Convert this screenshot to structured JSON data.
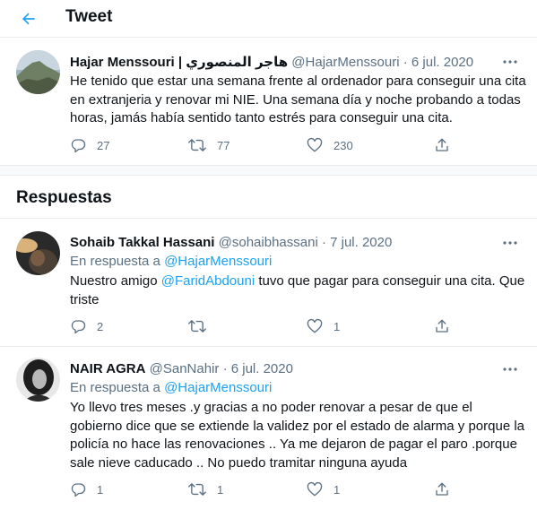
{
  "header": {
    "title": "Tweet"
  },
  "main_tweet": {
    "name": "Hajar Menssouri | هاجر المنصوري",
    "handle": "@HajarMenssouri",
    "date": "· 6 jul. 2020",
    "text": "He tenido que estar una semana frente al ordenador para conseguir una cita en extranjeria y renovar mi NIE. Una semana día y noche probando a todas horas, jamás había sentido tanto estrés para conseguir una cita.",
    "replies": "27",
    "retweets": "77",
    "likes": "230"
  },
  "section_title": "Respuestas",
  "replies": [
    {
      "name": "Sohaib Takkal Hassani",
      "handle": "@sohaibhassani",
      "date": "· 7 jul. 2020",
      "reply_label": "En respuesta a",
      "reply_to": "@HajarMenssouri",
      "text_before": "Nuestro amigo",
      "mention": "@FaridAbdouni",
      "text_after": "tuvo que pagar para conseguir una cita. Que triste",
      "replies": "2",
      "retweets": "",
      "likes": "1"
    },
    {
      "name": "NAIR AGRA",
      "handle": "@SanNahir",
      "date": "· 6 jul. 2020",
      "reply_label": "En respuesta a",
      "reply_to": "@HajarMenssouri",
      "text": "Yo llevo tres meses .y gracias a no poder renovar a pesar de que el gobierno dice que se extiende la validez por el estado de alarma y porque la policía no hace las renovaciones .. Ya me dejaron de pagar el paro .porque sale nieve caducado .. No puedo tramitar ninguna ayuda",
      "replies": "1",
      "retweets": "1",
      "likes": "1"
    }
  ],
  "colors": {
    "accent": "#1da1f2",
    "secondary_text": "#5b7083",
    "divider": "#e6ecf0"
  },
  "icons": [
    "back-arrow-icon",
    "more-icon",
    "reply-icon",
    "retweet-icon",
    "like-icon",
    "share-icon"
  ]
}
